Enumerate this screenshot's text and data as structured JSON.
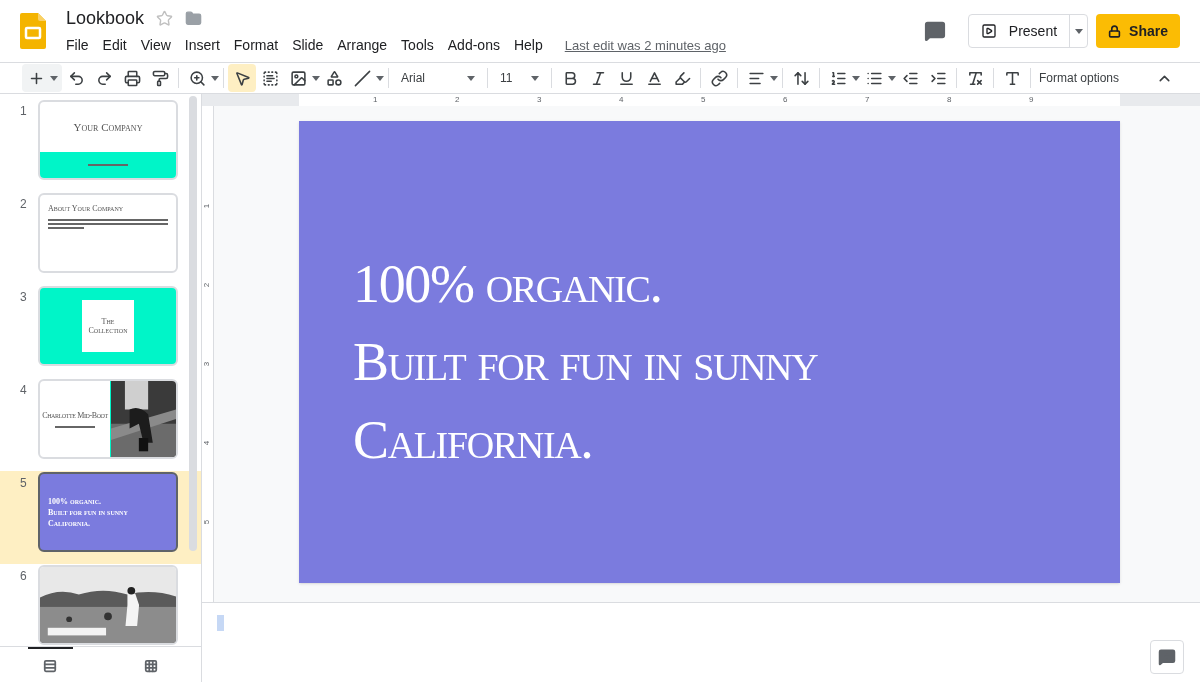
{
  "document": {
    "title": "Lookbook",
    "starred": false
  },
  "menu": [
    "File",
    "Edit",
    "View",
    "Insert",
    "Format",
    "Slide",
    "Arrange",
    "Tools",
    "Add-ons",
    "Help"
  ],
  "last_edit": "Last edit was 2 minutes ago",
  "present_label": "Present",
  "share_label": "Share",
  "toolbar": {
    "font": "Arial",
    "size": "11",
    "format_options": "Format options"
  },
  "ruler": {
    "horizontal": [
      "1",
      "2",
      "3",
      "4",
      "5",
      "6",
      "7",
      "8",
      "9"
    ],
    "vertical": [
      "1",
      "2",
      "3",
      "4",
      "5"
    ]
  },
  "slides": [
    {
      "number": "1",
      "kind": "title",
      "selected": false,
      "title": "Your Company"
    },
    {
      "number": "2",
      "kind": "text",
      "selected": false,
      "title": "About Your Company"
    },
    {
      "number": "3",
      "kind": "boxed",
      "selected": false,
      "title": "The Collection"
    },
    {
      "number": "4",
      "kind": "split",
      "selected": false,
      "title": "Charlotte Mid-Boot"
    },
    {
      "number": "5",
      "kind": "statement",
      "selected": true,
      "lines": [
        "100% organic.",
        "Built for fun in sunny",
        "California."
      ]
    },
    {
      "number": "6",
      "selected": false
    }
  ],
  "current_slide": {
    "lines": [
      "100% organic.",
      "Built for fun in sunny",
      "California."
    ]
  },
  "views": [
    {
      "kind": "filmstrip",
      "selected": true
    },
    {
      "kind": "grid",
      "selected": false
    }
  ]
}
